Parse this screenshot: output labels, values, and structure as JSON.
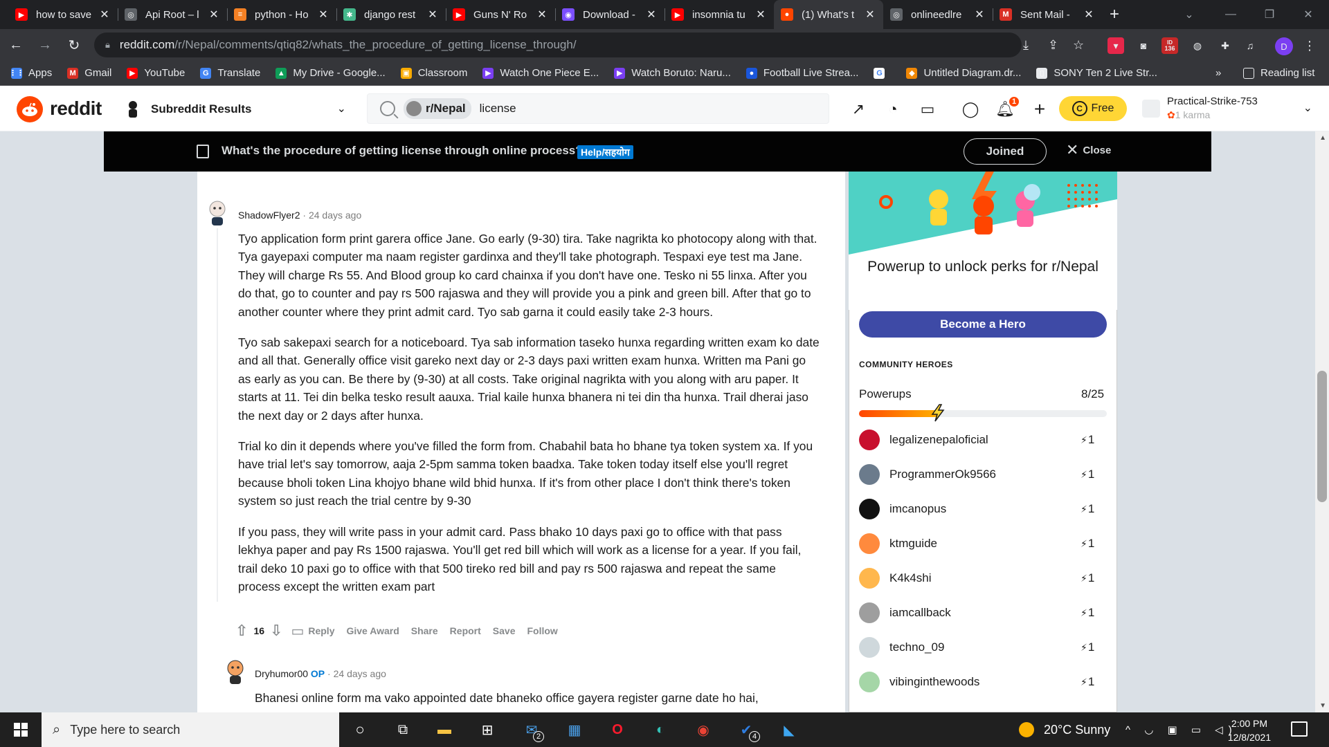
{
  "browser": {
    "tabs": [
      {
        "title": "how to save",
        "favicon": "youtube-icon",
        "color": "#ff0000",
        "glyph": "▶"
      },
      {
        "title": "Api Root – l",
        "favicon": "globe-icon",
        "color": "#5f6368",
        "glyph": "◎"
      },
      {
        "title": "python - Ho",
        "favicon": "stackoverflow-icon",
        "color": "#f48024",
        "glyph": "≡"
      },
      {
        "title": "django rest",
        "favicon": "django-icon",
        "color": "#44b78b",
        "glyph": "✱"
      },
      {
        "title": "Guns N' Ro",
        "favicon": "youtube-icon",
        "color": "#ff0000",
        "glyph": "▶"
      },
      {
        "title": "Download -",
        "favicon": "download-icon",
        "color": "#7b4fff",
        "glyph": "◉"
      },
      {
        "title": "insomnia tu",
        "favicon": "youtube-icon",
        "color": "#ff0000",
        "glyph": "▶"
      },
      {
        "title": "(1) What's t",
        "favicon": "reddit-icon",
        "color": "#ff4500",
        "glyph": "●",
        "active": true
      },
      {
        "title": "onlineedlre",
        "favicon": "globe-icon",
        "color": "#5f6368",
        "glyph": "◎"
      },
      {
        "title": "Sent Mail -",
        "favicon": "gmail-icon",
        "color": "#d93025",
        "glyph": "M"
      }
    ],
    "url_host": "reddit.com",
    "url_path": "/r/Nepal/comments/qtiq82/whats_the_procedure_of_getting_license_through/",
    "extension_badge": "136",
    "profile_initial": "D",
    "bookmarks": [
      {
        "label": "Apps",
        "icon": "apps-grid-icon",
        "color": "#4285f4",
        "glyph": "⋮⋮"
      },
      {
        "label": "Gmail",
        "icon": "gmail-icon",
        "color": "#d93025",
        "glyph": "M"
      },
      {
        "label": "YouTube",
        "icon": "youtube-icon",
        "color": "#ff0000",
        "glyph": "▶"
      },
      {
        "label": "Translate",
        "icon": "translate-icon",
        "color": "#4285f4",
        "glyph": "G"
      },
      {
        "label": "My Drive - Google...",
        "icon": "drive-icon",
        "color": "#0f9d58",
        "glyph": "▲"
      },
      {
        "label": "Classroom",
        "icon": "classroom-icon",
        "color": "#f9ab00",
        "glyph": "▣"
      },
      {
        "label": "Watch One Piece E...",
        "icon": "play-icon",
        "color": "#7b3ff2",
        "glyph": "▶"
      },
      {
        "label": "Watch Boruto: Naru...",
        "icon": "play-icon",
        "color": "#7b3ff2",
        "glyph": "▶"
      },
      {
        "label": "Football Live Strea...",
        "icon": "football-icon",
        "color": "#1a56db",
        "glyph": "●"
      },
      {
        "label": "",
        "icon": "google-icon",
        "color": "#ffffff",
        "glyph": "G"
      },
      {
        "label": "Untitled Diagram.dr...",
        "icon": "drawio-icon",
        "color": "#f08705",
        "glyph": "◆"
      },
      {
        "label": "SONY Ten 2 Live Str...",
        "icon": "page-icon",
        "color": "#e8eaed",
        "glyph": "▯"
      }
    ],
    "reading_list": "Reading list"
  },
  "reddit_header": {
    "logo_text": "reddit",
    "subreddit_selector": "Subreddit Results",
    "search_chip": "r/Nepal",
    "search_query": "license",
    "free_label": "Free",
    "notification_count": "1",
    "username": "Practical-Strike-753",
    "karma": "1 karma"
  },
  "post_bar": {
    "title": "What's the procedure of getting license through online process?",
    "flair": "Help/सहयोग",
    "joined_label": "Joined",
    "close_label": "Close"
  },
  "comments": [
    {
      "author": "ShadowFlyer2",
      "time": "24 days ago",
      "paragraphs": [
        "Tyo application form print garera office Jane. Go early (9-30) tira. Take nagrikta ko photocopy along with that. Tya gayepaxi computer ma naam register gardinxa and they'll take photograph. Tespaxi eye test ma Jane. They will charge Rs 55. And Blood group ko card chainxa if you don't have one. Tesko ni 55 linxa. After you do that, go to counter and pay rs 500 rajaswa and they will provide you a pink and green bill. After that go to another counter where they print admit card. Tyo sab garna it could easily take 2-3 hours.",
        "Tyo sab sakepaxi search for a noticeboard. Tya sab information taseko hunxa regarding written exam ko date and all that. Generally office visit gareko next day or 2-3 days paxi written exam hunxa. Written ma Pani go as early as you can. Be there by (9-30) at all costs. Take original nagrikta with you along with aru paper. It starts at 11. Tei din belka tesko result aauxa. Trial kaile hunxa bhanera ni tei din tha hunxa. Trail dherai jaso the next day or 2 days after hunxa.",
        "Trial ko din it depends where you've filled the form from. Chabahil bata ho bhane tya token system xa. If you have trial let's say tomorrow, aaja 2-5pm samma token baadxa. Take token today itself else you'll regret because bholi token Lina khojyo bhane wild bhid hunxa. If it's from other place I don't think there's token system so just reach the trial centre by 9-30",
        "If you pass, they will write pass in your admit card. Pass bhako 10 days paxi go to office with that pass lekhya paper and pay Rs 1500 rajaswa. You'll get red bill which will work as a license for a year. If you fail, trail deko 10 paxi go to office with that 500 tireko red bill and pay rs 500 rajaswa and repeat the same process except the written exam part"
      ],
      "votes": "16",
      "actions": [
        "Reply",
        "Give Award",
        "Share",
        "Report",
        "Save",
        "Follow"
      ]
    },
    {
      "author": "Dryhumor00",
      "op_tag": "OP",
      "time": "24 days ago",
      "paragraphs": [
        "Bhanesi online form ma vako appointed date bhaneko office gayera register garne date ho hai,"
      ]
    }
  ],
  "sidebar": {
    "powerup_title": "Powerup to unlock perks for r/Nepal",
    "hero_button": "Become a Hero",
    "community_heroes_label": "COMMUNITY HEROES",
    "powerups_label": "Powerups",
    "powerups_count": "8/25",
    "powerups_fraction": 0.32,
    "heroes": [
      {
        "name": "legalizenepaloficial",
        "value": "1",
        "color": "#c8102e"
      },
      {
        "name": "ProgrammerOk9566",
        "value": "1",
        "color": "#6b7b8c"
      },
      {
        "name": "imcanopus",
        "value": "1",
        "color": "#111111"
      },
      {
        "name": "ktmguide",
        "value": "1",
        "color": "#ff8a3d"
      },
      {
        "name": "K4k4shi",
        "value": "1",
        "color": "#ffb74d"
      },
      {
        "name": "iamcallback",
        "value": "1",
        "color": "#9e9e9e"
      },
      {
        "name": "techno_09",
        "value": "1",
        "color": "#cfd8dc"
      },
      {
        "name": "vibinginthewoods",
        "value": "1",
        "color": "#a5d6a7"
      }
    ]
  },
  "taskbar": {
    "search_placeholder": "Type here to search",
    "weather": "20°C  Sunny",
    "time": "2:00 PM",
    "date": "12/8/2021",
    "mail_badge": "2",
    "vscode_badge": "4"
  }
}
